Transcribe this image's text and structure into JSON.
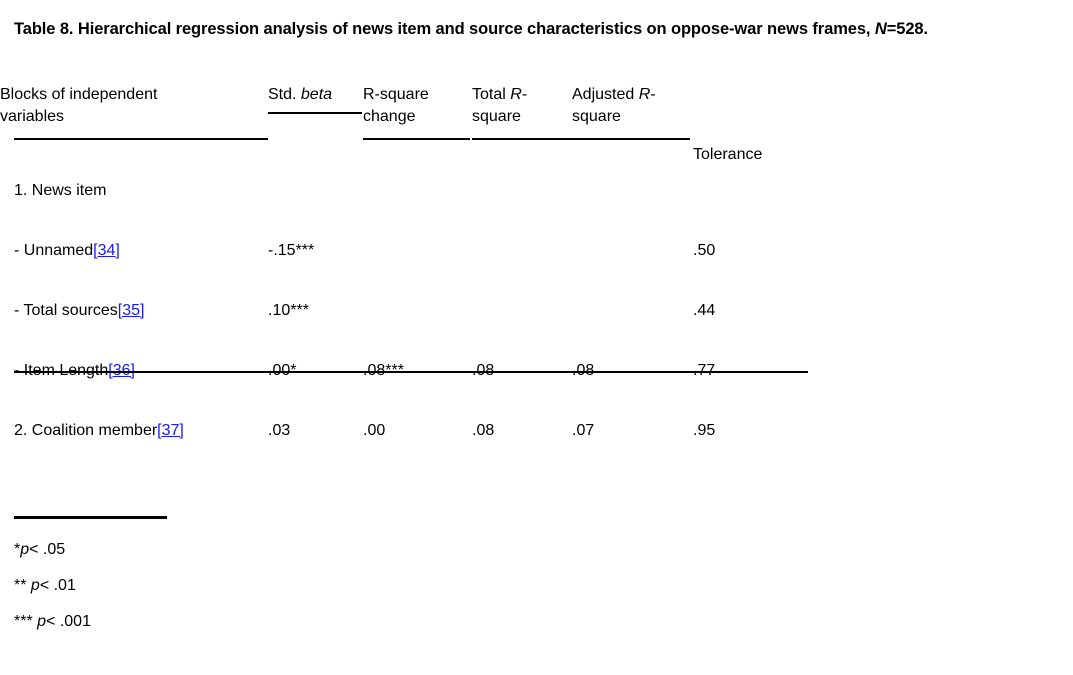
{
  "caption": {
    "line1_prefix": "Table 8. Hierarchical regression analysis of news item and source characteristics on oppose-war news",
    "line2_prefix": "frames, ",
    "line2_italic": "N",
    "line2_suffix": "=528."
  },
  "header": {
    "label_line1": "Blocks of independent",
    "label_line2": "variables",
    "beta_plain": "Std. ",
    "beta_italic": "beta",
    "rsq_change_italic": "R-square",
    "rsq_change_plain": "change",
    "total_plain": "Total ",
    "total_italic_r": "R",
    "total_dash": "-",
    "total_italic_square": "square",
    "adjusted_plain": "Adjusted ",
    "adjusted_italic_r": "R",
    "adjusted_dash": "-",
    "adjusted_italic_square": "square",
    "tolerance": "Tolerance"
  },
  "rows": [
    {
      "label": "1. News item",
      "ref": "",
      "beta": "",
      "rsq_change": "",
      "total_rsq": "",
      "adjusted_rsq": "",
      "tolerance": ""
    },
    {
      "label": "- Unnamed",
      "ref": "[34]",
      "beta": "-.15***",
      "rsq_change": "",
      "total_rsq": "",
      "adjusted_rsq": "",
      "tolerance": ".50"
    },
    {
      "label": "- Total sources",
      "ref": "[35]",
      "beta": ".10***",
      "rsq_change": "",
      "total_rsq": "",
      "adjusted_rsq": "",
      "tolerance": ".44"
    },
    {
      "label": "- Item Length",
      "ref": "[36]",
      "beta": ".00*",
      "rsq_change": ".08***",
      "total_rsq": ".08",
      "adjusted_rsq": ".08",
      "tolerance": ".77"
    },
    {
      "label": "2. Coalition member",
      "ref": "[37]",
      "beta": ".03",
      "rsq_change": ".00",
      "total_rsq": ".08",
      "adjusted_rsq": ".07",
      "tolerance": ".95"
    }
  ],
  "footnotes": {
    "f1_stars": "*",
    "f1_italic": "p",
    "f1_rest": "< .05",
    "f2_stars": "** ",
    "f2_italic": "p",
    "f2_rest": "< .01",
    "f3_stars": "*** ",
    "f3_italic": "p",
    "f3_rest": "< .001"
  },
  "colors": {
    "link": "#1a1aee",
    "text": "#000000",
    "background": "#ffffff"
  }
}
